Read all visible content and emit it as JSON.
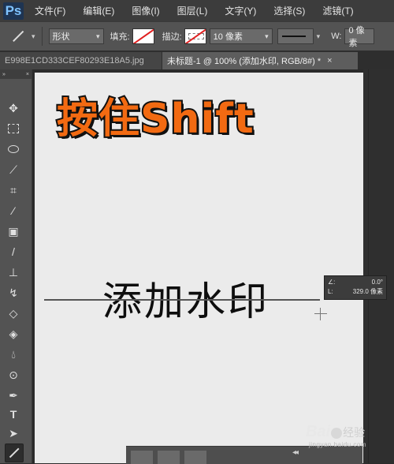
{
  "app": {
    "logo": "Ps"
  },
  "menu": [
    "文件(F)",
    "编辑(E)",
    "图像(I)",
    "图层(L)",
    "文字(Y)",
    "选择(S)",
    "滤镜(T)"
  ],
  "options": {
    "tool_mode": "形状",
    "fill_label": "填充:",
    "stroke_label": "描边:",
    "stroke_width": "10 像素",
    "width_label": "W:",
    "width_value": "0 像素"
  },
  "tabs": [
    {
      "label": "E998E1CD333CEF80293E18A5.jpg",
      "active": false
    },
    {
      "label": "未标题-1 @ 100% (添加水印, RGB/8#) *",
      "active": true,
      "close": "×"
    }
  ],
  "tools_panel": {
    "collapse": "»",
    "close": "×"
  },
  "canvas": {
    "title_text": "按住Shift",
    "watermark_text": "添加水印"
  },
  "measure_tooltip": {
    "angle_label": "∠:",
    "angle_value": "0.0°",
    "length_label": "L:",
    "length_value": "329.0 像素"
  },
  "collapse_arrows": "◂◂",
  "watermark_site": {
    "brand": "Bai",
    "brand2": "经验",
    "url": "jingyan.baidu.com"
  },
  "colors": {
    "accent_orange": "#f26a12",
    "fill_swatch_slash": "#e02020"
  }
}
